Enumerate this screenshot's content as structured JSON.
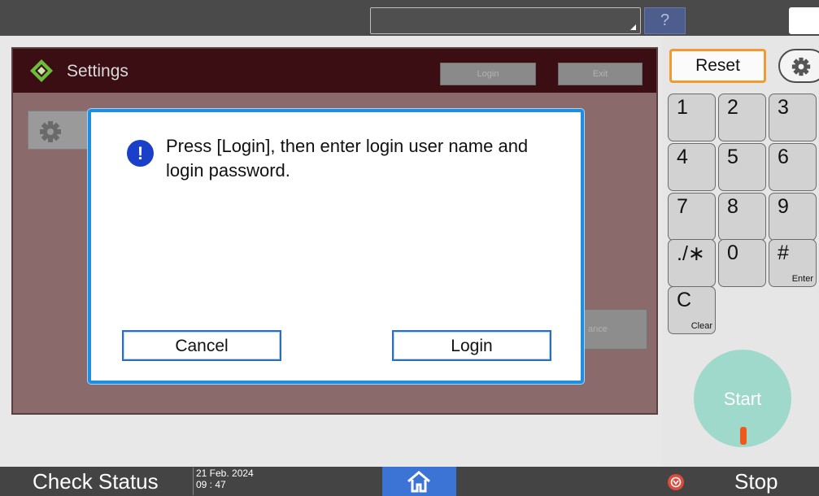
{
  "topbar": {
    "help_label": "?",
    "help_icon": "question-icon",
    "theme_icon": "moon-icon"
  },
  "settings": {
    "title": "Settings",
    "logo_icon": "settings-logo-icon",
    "login_label": "Login",
    "exit_label": "Exit",
    "tile_icon": "gear-icon",
    "maintenance_partial": "ance"
  },
  "dialog": {
    "message": "Press [Login], then enter login user name and login password.",
    "icon": "info-icon",
    "icon_glyph": "!",
    "cancel_label": "Cancel",
    "login_label": "Login"
  },
  "keypad": {
    "reset_label": "Reset",
    "config_icon": "gear-icon",
    "keys": [
      {
        "main": "1",
        "sub": ""
      },
      {
        "main": "2",
        "sub": ""
      },
      {
        "main": "3",
        "sub": ""
      },
      {
        "main": "4",
        "sub": ""
      },
      {
        "main": "5",
        "sub": ""
      },
      {
        "main": "6",
        "sub": ""
      },
      {
        "main": "7",
        "sub": ""
      },
      {
        "main": "8",
        "sub": ""
      },
      {
        "main": "9",
        "sub": ""
      },
      {
        "main": "./∗",
        "sub": ""
      },
      {
        "main": "0",
        "sub": ""
      },
      {
        "main": "#",
        "sub": "Enter"
      },
      {
        "main": "C",
        "sub": "Clear"
      }
    ],
    "start_label": "Start"
  },
  "bottombar": {
    "check_status_label": "Check Status",
    "date": "21 Feb. 2024",
    "time": "09 : 47",
    "home_icon": "home-icon",
    "stop_icon": "stop-icon",
    "stop_label": "Stop"
  },
  "colors": {
    "dialog_border": "#1e8fe0",
    "reset_border": "#f29a2e",
    "start_button": "#9fd9cb",
    "home_button": "#3b74d4",
    "header_bg": "#3a0e12"
  }
}
